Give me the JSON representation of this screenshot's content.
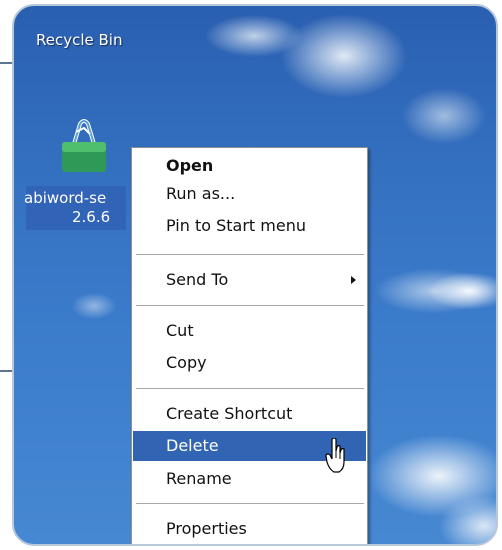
{
  "desktop": {
    "recycle_bin_label": "Recycle Bin",
    "selected_icon": {
      "icon": "abiword-installer-icon",
      "label_line1": "abiword-se",
      "label_line2": "2.6.6"
    }
  },
  "context_menu": {
    "items": [
      {
        "label": "Open",
        "bold": true
      },
      {
        "label": "Run as..."
      },
      {
        "label": "Pin to Start menu"
      },
      {
        "label": "Send To",
        "submenu": true
      },
      {
        "label": "Cut"
      },
      {
        "label": "Copy"
      },
      {
        "label": "Create Shortcut"
      },
      {
        "label": "Delete",
        "selected": true
      },
      {
        "label": "Rename"
      },
      {
        "label": "Properties"
      }
    ]
  },
  "colors": {
    "selection": "#3264b4",
    "desktop_sky": "#3470c0",
    "menu_background": "#ffffff"
  }
}
